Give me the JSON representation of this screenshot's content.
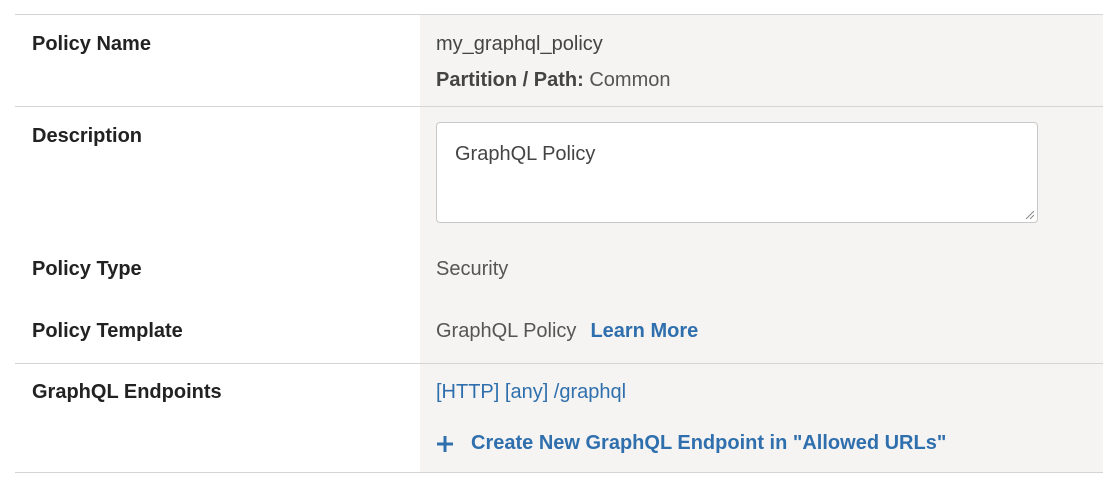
{
  "policy_name": {
    "label": "Policy Name",
    "value": "my_graphql_policy",
    "partition_label": "Partition / Path:",
    "partition_value": "Common"
  },
  "description": {
    "label": "Description",
    "value": "GraphQL Policy"
  },
  "policy_type": {
    "label": "Policy Type",
    "value": "Security"
  },
  "policy_template": {
    "label": "Policy Template",
    "value": "GraphQL Policy",
    "learn_more": "Learn More"
  },
  "graphql_endpoints": {
    "label": "GraphQL Endpoints",
    "endpoint": "[HTTP] [any] /graphql",
    "create_link": "Create New GraphQL Endpoint in \"Allowed URLs\""
  },
  "icons": {
    "plus": "plus-icon",
    "resize": "resize-grip-icon"
  },
  "colors": {
    "link": "#2f6fad",
    "value_bg": "#f5f4f2",
    "border": "#d4d4d4"
  }
}
